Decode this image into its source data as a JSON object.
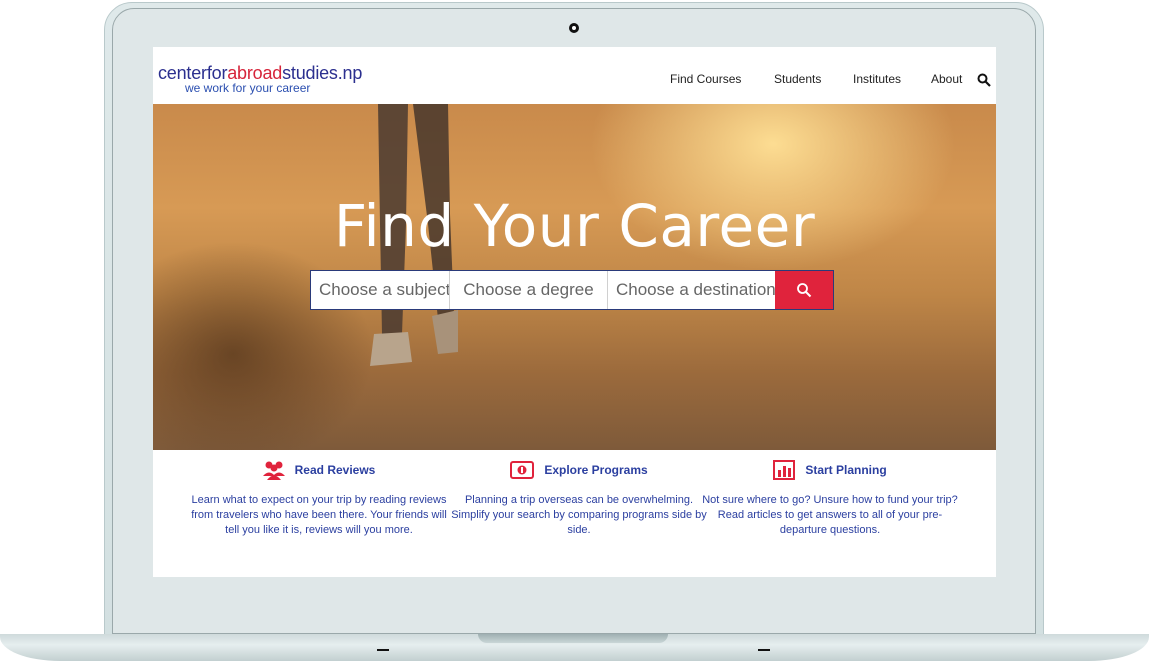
{
  "header": {
    "logo_parts": [
      "centerfor",
      "abroad",
      "studies.np"
    ],
    "tagline": "we work for your career",
    "nav": [
      "Find Courses",
      "Students",
      "Institutes",
      "About"
    ]
  },
  "hero": {
    "title": "Find Your Career",
    "search": {
      "subject_placeholder": "Choose a subject",
      "degree_placeholder": "Choose a degree",
      "destination_placeholder": "Choose a destination"
    }
  },
  "features": [
    {
      "icon": "people-icon",
      "title": "Read Reviews",
      "text": "Learn what to expect on your trip by reading reviews from travelers who have been there. Your friends will tell you like it is, reviews will you more."
    },
    {
      "icon": "money-icon",
      "title": "Explore Programs",
      "text": "Planning a trip overseas can be overwhelming. Simplify your search by comparing programs side by side."
    },
    {
      "icon": "bar-chart-icon",
      "title": "Start Planning",
      "text": "Not sure where to go? Unsure how to fund your trip? Read articles to get answers to all of your pre-departure questions."
    }
  ],
  "colors": {
    "brand_blue": "#2b3fa0",
    "accent_red": "#e0233c"
  }
}
